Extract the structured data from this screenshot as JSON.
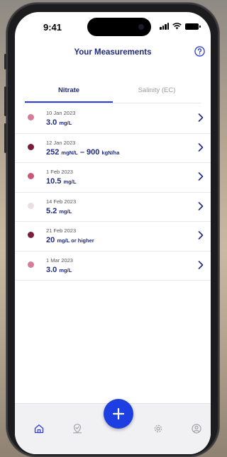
{
  "status_bar": {
    "time": "9:41"
  },
  "header": {
    "title": "Your Measurements",
    "help_icon": "help-circle-icon"
  },
  "tabs": [
    {
      "label": "Nitrate",
      "active": true
    },
    {
      "label": "Salinity (EC)",
      "active": false
    }
  ],
  "measurements": [
    {
      "date": "10 Jan 2023",
      "value": "3.0",
      "unit": "mg/L",
      "dot_color": "#d67c95"
    },
    {
      "date": "12 Jan 2023",
      "value": "252",
      "unit": "mgN/L",
      "value2": "900",
      "unit2": "kgN/ha",
      "dot_color": "#7a1c3b"
    },
    {
      "date": "1 Feb 2023",
      "value": "10.5",
      "unit": "mg/L",
      "dot_color": "#c9577a"
    },
    {
      "date": "14 Feb 2023",
      "value": "5.2",
      "unit": "mg/L",
      "dot_color": "#ecdfe4"
    },
    {
      "date": "21 Feb 2023",
      "value": "20",
      "unit": "mg/L or higher",
      "dot_color": "#7d1f3e"
    },
    {
      "date": "1 Mar 2023",
      "value": "3.0",
      "unit": "mg/L",
      "dot_color": "#d67c95"
    }
  ],
  "bottom_nav": {
    "items": [
      "home-icon",
      "map-pin-icon",
      "add-icon",
      "settings-icon",
      "profile-icon"
    ],
    "active_color": "#2d3fd8",
    "inactive_color": "#a0a0a8"
  },
  "colors": {
    "brand": "#1f2b7a",
    "accent": "#2d3fd8",
    "fab": "#1d3ee0"
  }
}
